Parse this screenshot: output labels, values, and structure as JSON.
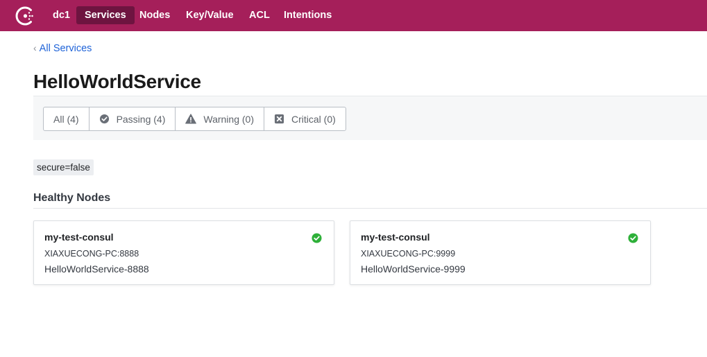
{
  "topbar": {
    "background": "#a51f5a",
    "active_background": "#6e1440",
    "logo_icon": "consul-logo-icon",
    "datacenter": "dc1",
    "nav": [
      {
        "label": "Services",
        "active": true
      },
      {
        "label": "Nodes",
        "active": false
      },
      {
        "label": "Key/Value",
        "active": false
      },
      {
        "label": "ACL",
        "active": false
      },
      {
        "label": "Intentions",
        "active": false
      }
    ]
  },
  "breadcrumb": {
    "icon": "chevron-left-icon",
    "label": "All Services"
  },
  "page_title": "HelloWorldService",
  "filters": [
    {
      "label": "All (4)",
      "icon": null,
      "selected": true
    },
    {
      "label": "Passing (4)",
      "icon": "check-circle-icon"
    },
    {
      "label": "Warning (0)",
      "icon": "warning-triangle-icon"
    },
    {
      "label": "Critical (0)",
      "icon": "x-square-icon"
    }
  ],
  "tags": [
    "secure=false"
  ],
  "healthy_nodes": {
    "heading": "Healthy Nodes",
    "status_color": "#2eb039",
    "cards": [
      {
        "node": "my-test-consul",
        "address": "XIAXUECONG-PC:8888",
        "service_id": "HelloWorldService-8888",
        "status_icon": "check-circle-icon"
      },
      {
        "node": "my-test-consul",
        "address": "XIAXUECONG-PC:9999",
        "service_id": "HelloWorldService-9999",
        "status_icon": "check-circle-icon"
      }
    ]
  },
  "colors": {
    "link": "#1f63d8",
    "icon_gray": "#6a6f77"
  }
}
